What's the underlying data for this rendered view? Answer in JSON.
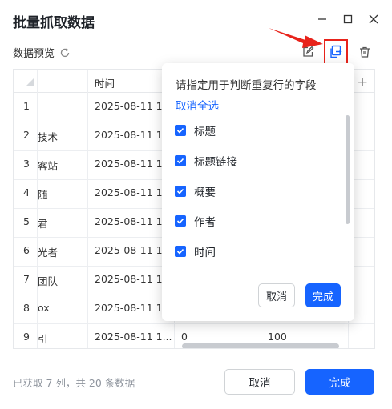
{
  "window": {
    "title": "批量抓取数据"
  },
  "toolbar": {
    "preview_label": "数据预览"
  },
  "table": {
    "columns": [
      "",
      "时间"
    ],
    "rows": [
      {
        "index": "1",
        "col1": "",
        "time": "2025-08-11 1..."
      },
      {
        "index": "2",
        "col1": "技术",
        "time": "2025-08-11 1..."
      },
      {
        "index": "3",
        "col1": "客站",
        "time": "2025-08-11 1..."
      },
      {
        "index": "4",
        "col1": "随",
        "time": "2025-08-11 1..."
      },
      {
        "index": "5",
        "col1": "君",
        "time": "2025-08-11 1..."
      },
      {
        "index": "6",
        "col1": "光者",
        "time": "2025-08-11 1..."
      },
      {
        "index": "7",
        "col1": "团队",
        "time": "2025-08-11 1..."
      },
      {
        "index": "8",
        "col1": "ox",
        "time": "2025-08-11 1..."
      },
      {
        "index": "9",
        "col1": "引",
        "time": "2025-08-11 1..."
      }
    ],
    "partial_cells": {
      "c3": "0",
      "c4": "100"
    }
  },
  "popup": {
    "title": "请指定用于判断重复行的字段",
    "deselect_all": "取消全选",
    "fields": [
      {
        "label": "标题",
        "checked": true
      },
      {
        "label": "标题链接",
        "checked": true
      },
      {
        "label": "概要",
        "checked": true
      },
      {
        "label": "作者",
        "checked": true
      },
      {
        "label": "时间",
        "checked": true
      }
    ],
    "cancel": "取消",
    "confirm": "完成"
  },
  "footer": {
    "status": "已获取 7 列，共 20 条数据",
    "cancel": "取消",
    "confirm": "完成"
  },
  "colors": {
    "accent": "#1664ff",
    "highlight": "#e8231b"
  }
}
